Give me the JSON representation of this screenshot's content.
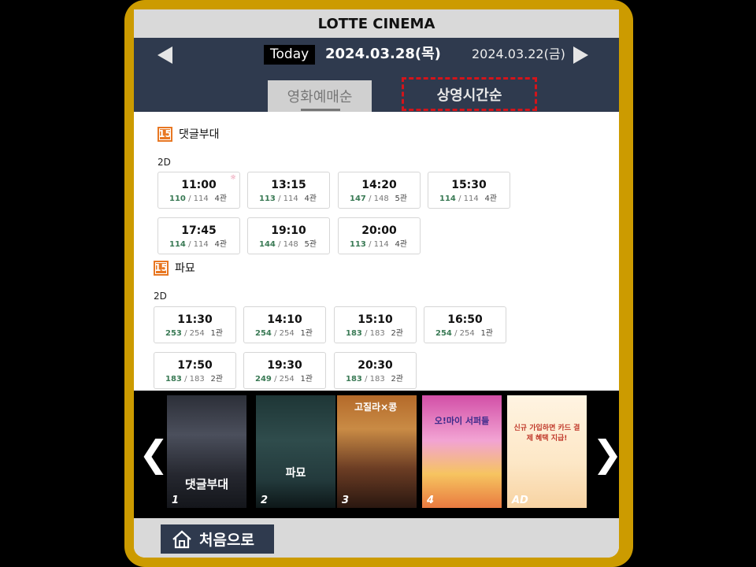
{
  "app": {
    "title": "LOTTE CINEMA"
  },
  "datebar": {
    "today_label": "Today",
    "current_date": "2024.03.28(목)",
    "next_date": "2024.03.22(금)"
  },
  "sort_tabs": [
    {
      "label": "영화예매순"
    },
    {
      "label": "상영시간순"
    }
  ],
  "movies": [
    {
      "rating": "15",
      "title": "댓글부대",
      "format": "2D",
      "showtimes": [
        {
          "time": "11:00",
          "available": "110",
          "total": "/ 114",
          "hall": "4관",
          "morning": true
        },
        {
          "time": "13:15",
          "available": "113",
          "total": "/ 114",
          "hall": "4관"
        },
        {
          "time": "14:20",
          "available": "147",
          "total": "/ 148",
          "hall": "5관"
        },
        {
          "time": "15:30",
          "available": "114",
          "total": "/ 114",
          "hall": "4관"
        },
        {
          "time": "17:45",
          "available": "114",
          "total": "/ 114",
          "hall": "4관"
        },
        {
          "time": "19:10",
          "available": "144",
          "total": "/ 148",
          "hall": "5관"
        },
        {
          "time": "20:00",
          "available": "113",
          "total": "/ 114",
          "hall": "4관"
        }
      ]
    },
    {
      "rating": "15",
      "title": "파묘",
      "format": "2D",
      "showtimes": [
        {
          "time": "11:30",
          "available": "253",
          "total": "/ 254",
          "hall": "1관"
        },
        {
          "time": "14:10",
          "available": "254",
          "total": "/ 254",
          "hall": "1관"
        },
        {
          "time": "15:10",
          "available": "183",
          "total": "/ 183",
          "hall": "2관"
        },
        {
          "time": "16:50",
          "available": "254",
          "total": "/ 254",
          "hall": "1관"
        },
        {
          "time": "17:50",
          "available": "183",
          "total": "/ 183",
          "hall": "2관"
        },
        {
          "time": "19:30",
          "available": "249",
          "total": "/ 254",
          "hall": "1관"
        },
        {
          "time": "20:30",
          "available": "183",
          "total": "/ 183",
          "hall": "2관"
        }
      ]
    }
  ],
  "posters": [
    {
      "num": "1",
      "title": "댓글부대"
    },
    {
      "num": "2",
      "title": "파묘"
    },
    {
      "num": "3",
      "title": "고질라×콩"
    },
    {
      "num": "4",
      "title": "오!마이 서퍼들"
    },
    {
      "num": "AD",
      "title": "신규 가입하면 카드 결제 혜택 지급!"
    }
  ],
  "carousel": {
    "prev_glyph": "❮",
    "next_glyph": "❯"
  },
  "home": {
    "label": "처음으로"
  },
  "colors": {
    "frame": "#cc9b00",
    "header_bg": "#2f3a4e",
    "rating_15": "#e87722",
    "seat_available": "#3a7a55",
    "highlight_border": "#d4141a"
  }
}
